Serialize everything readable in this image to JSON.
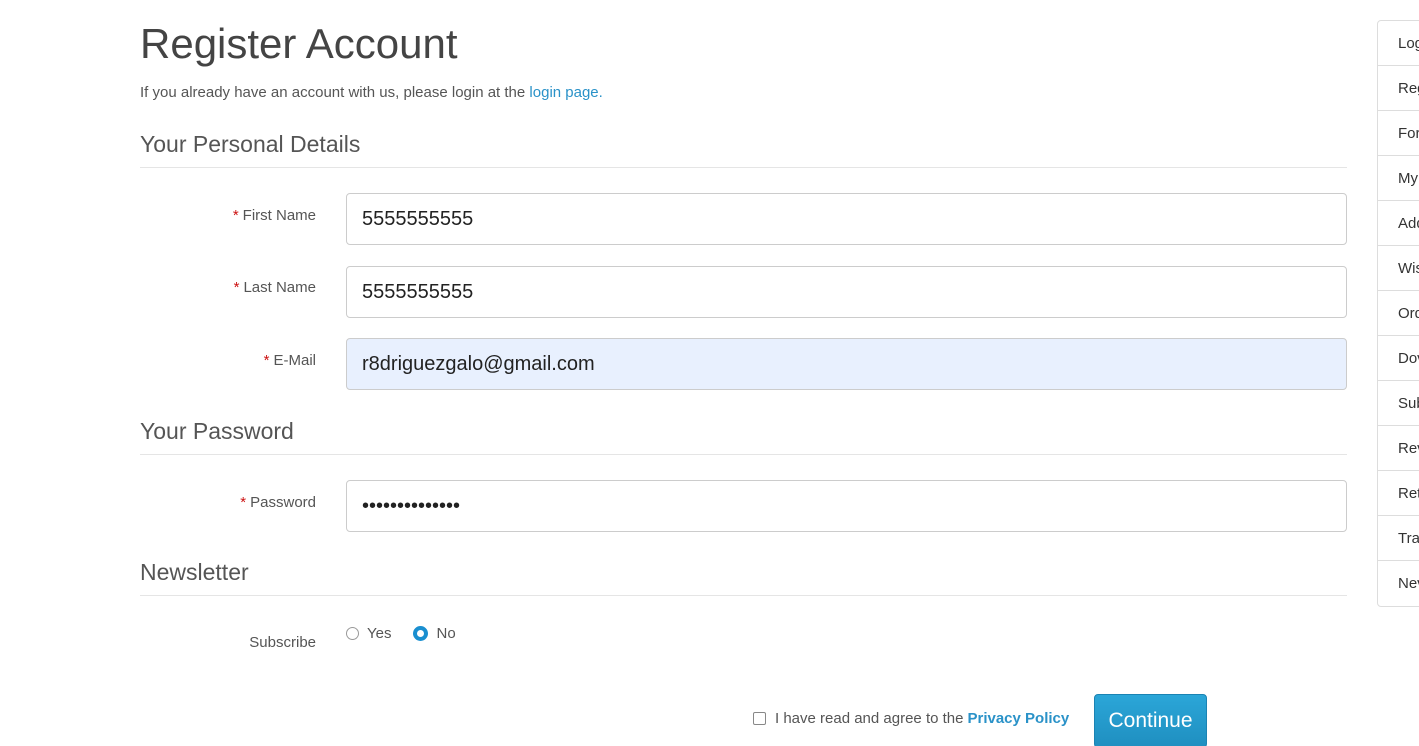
{
  "header": {
    "title": "Register Account",
    "intro_text": "If you already have an account with us, please login at the ",
    "login_link": "login page."
  },
  "personal": {
    "legend": "Your Personal Details",
    "first_name": {
      "label": "First Name",
      "value": "5555555555"
    },
    "last_name": {
      "label": "Last Name",
      "value": "5555555555"
    },
    "email": {
      "label": "E-Mail",
      "value": "r8driguezgalo@gmail.com"
    }
  },
  "password_section": {
    "legend": "Your Password",
    "password": {
      "label": "Password",
      "value": "••••••••••••••"
    }
  },
  "newsletter": {
    "legend": "Newsletter",
    "label": "Subscribe",
    "options": [
      {
        "label": "Yes",
        "checked": false
      },
      {
        "label": "No",
        "checked": true
      }
    ]
  },
  "agree": {
    "text": "I have read and agree to the",
    "link": "Privacy Policy"
  },
  "actions": {
    "continue_label": "Continue"
  },
  "required_marker": "*",
  "sidebar": {
    "items": [
      {
        "label": "Log"
      },
      {
        "label": "Reg"
      },
      {
        "label": "For"
      },
      {
        "label": "My"
      },
      {
        "label": "Add"
      },
      {
        "label": "Wis"
      },
      {
        "label": "Ord"
      },
      {
        "label": "Dov"
      },
      {
        "label": "Sub"
      },
      {
        "label": "Rev"
      },
      {
        "label": "Ret"
      },
      {
        "label": "Tra"
      },
      {
        "label": "Nev"
      }
    ]
  },
  "colors": {
    "link": "#2a92c8",
    "required": "#cc1111",
    "button": "#2198c9",
    "autofill_bg": "#e8f0fe"
  }
}
